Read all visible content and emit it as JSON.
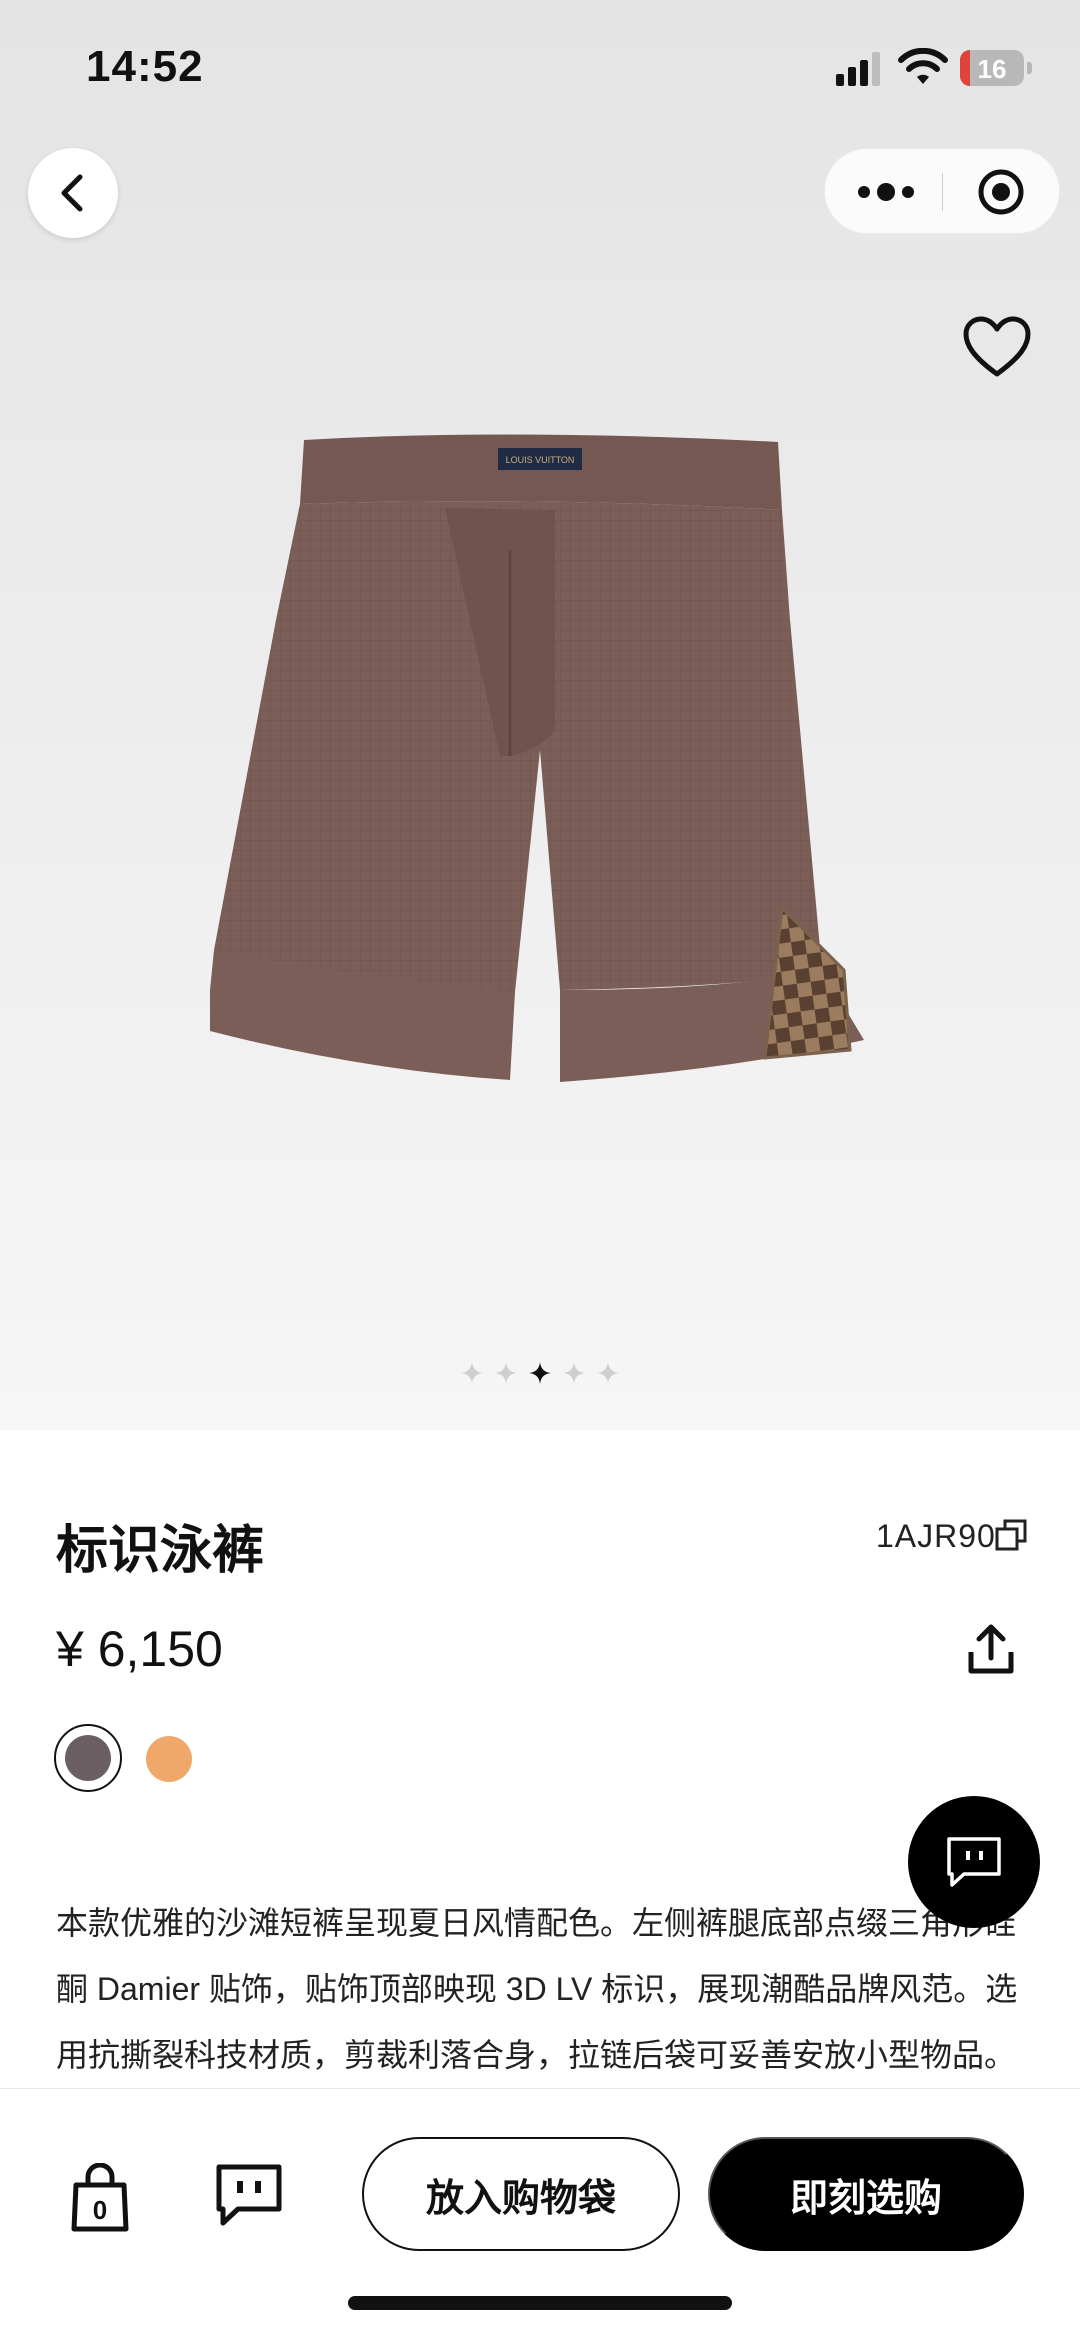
{
  "status_bar": {
    "time": "14:52",
    "battery": "16",
    "battery_level": 0.16
  },
  "nav": {
    "back_icon": "chevron-left-icon",
    "more_icon": "more-dots-icon",
    "close_icon": "target-close-icon"
  },
  "product": {
    "title": "标识泳裤",
    "sku": "1AJR90",
    "price": "¥ 6,150",
    "image_icon": "brown-swim-shorts",
    "image_count": 5,
    "active_image": 3,
    "colors": [
      {
        "name": "brown",
        "hex": "#6b5f63",
        "selected": true
      },
      {
        "name": "orange",
        "hex": "#f0a76a",
        "selected": false
      }
    ],
    "description": "本款优雅的沙滩短裤呈现夏日风情配色。左侧裤腿底部点缀三角形硅酮 Damier 贴饰，贴饰顶部映现 3D LV 标识，展现潮酷品牌风范。选用抗撕裂科技材质，剪裁利落合身，拉链后袋可妥善安放小型物品。"
  },
  "bottom_bar": {
    "bag_count": "0",
    "add_to_bag": "放入购物袋",
    "buy_now": "即刻选购"
  },
  "colors": {
    "accent": "#000000",
    "shorts": "#7b5e57",
    "damier_dark": "#5a4030",
    "damier_light": "#9c7c5f"
  }
}
